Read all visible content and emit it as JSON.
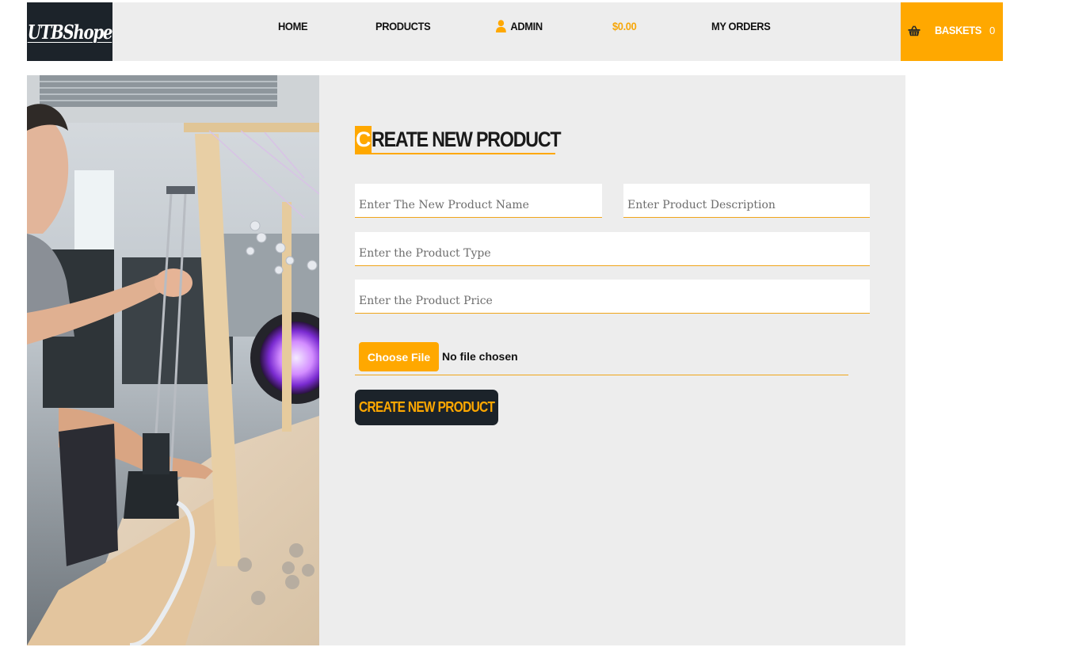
{
  "brand": {
    "logo_text": "UTBShope"
  },
  "nav": {
    "home": "HOME",
    "products": "PRODUCTS",
    "admin": "ADMIN",
    "balance": "$0.00",
    "orders": "MY ORDERS"
  },
  "basket": {
    "label": "BASKETS",
    "count": "0",
    "icon": "basket-icon"
  },
  "form": {
    "title_first": "C",
    "title_rest": "REATE NEW PRODUCT",
    "name_placeholder": "Enter The New Product Name",
    "description_placeholder": "Enter Product Description",
    "type_placeholder": "Enter the Product Type",
    "price_placeholder": "Enter the Product Price",
    "file_button": "Choose File",
    "file_status": "No file chosen",
    "submit_label": "CREATE NEW PRODUCT"
  },
  "colors": {
    "accent": "#ffa800",
    "dark": "#1c232a",
    "panel": "#ededed"
  }
}
